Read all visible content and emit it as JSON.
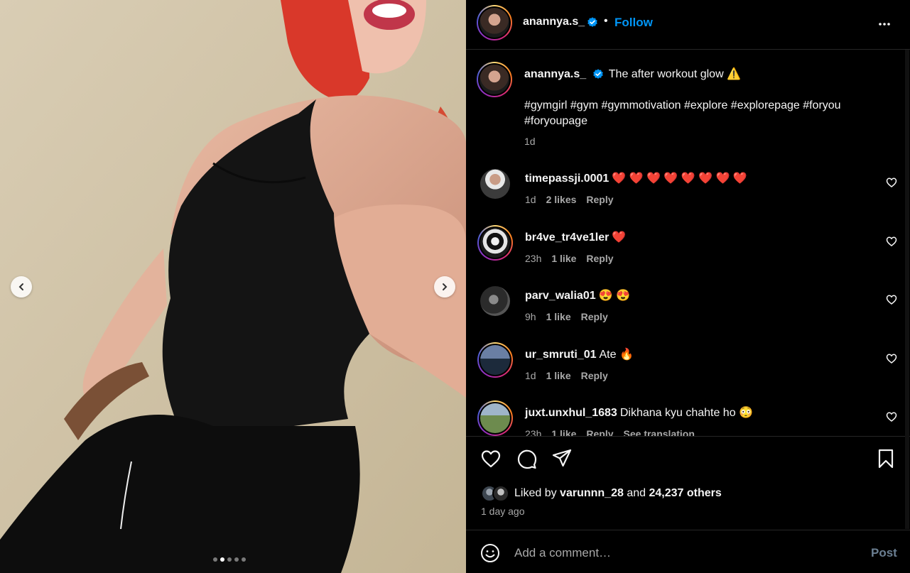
{
  "media": {
    "slide_count": 5,
    "active_slide_index": 1,
    "prev_label": "Previous",
    "next_label": "Next"
  },
  "header": {
    "username": "anannya.s_",
    "bullet": "•",
    "follow_label": "Follow"
  },
  "caption": {
    "username": "anannya.s_",
    "text": "The after workout glow ⚠️",
    "hashtags": "#gymgirl #gym #gymmotivation #explore #explorepage #foryou #foryoupage",
    "time": "1d"
  },
  "comments": [
    {
      "username": "timepassji.0001",
      "text": "❤️ ❤️ ❤️ ❤️ ❤️ ❤️ ❤️ ❤️",
      "time": "1d",
      "likes": "2 likes",
      "reply": "Reply",
      "extra": "",
      "story_ring": false
    },
    {
      "username": "br4ve_tr4ve1ler",
      "text": "❤️",
      "time": "23h",
      "likes": "1 like",
      "reply": "Reply",
      "extra": "",
      "story_ring": true
    },
    {
      "username": "parv_walia01",
      "text": "😍 😍",
      "time": "9h",
      "likes": "1 like",
      "reply": "Reply",
      "extra": "",
      "story_ring": false
    },
    {
      "username": "ur_smruti_01",
      "text": "Ate 🔥",
      "time": "1d",
      "likes": "1 like",
      "reply": "Reply",
      "extra": "",
      "story_ring": true
    },
    {
      "username": "juxt.unxhul_1683",
      "text": "Dikhana kyu chahte ho 😳",
      "time": "23h",
      "likes": "1 like",
      "reply": "Reply",
      "extra": "See translation",
      "story_ring": true
    }
  ],
  "likes": {
    "prefix": "Liked by",
    "user": "varunnn_28",
    "connector": "and",
    "others": "24,237 others"
  },
  "posted_ago": "1 day ago",
  "comment_box": {
    "placeholder": "Add a comment…",
    "post_label": "Post"
  },
  "colors": {
    "accent": "#0095f6",
    "background": "#000000",
    "muted_text": "#a8a8a8",
    "heart_red": "#ff3040"
  },
  "icons": {
    "more": "more-horizontal-icon",
    "like": "heart-icon",
    "comment": "comment-icon",
    "share": "share-icon",
    "save": "bookmark-icon",
    "emoji": "emoji-icon",
    "verified": "verified-badge-icon"
  }
}
